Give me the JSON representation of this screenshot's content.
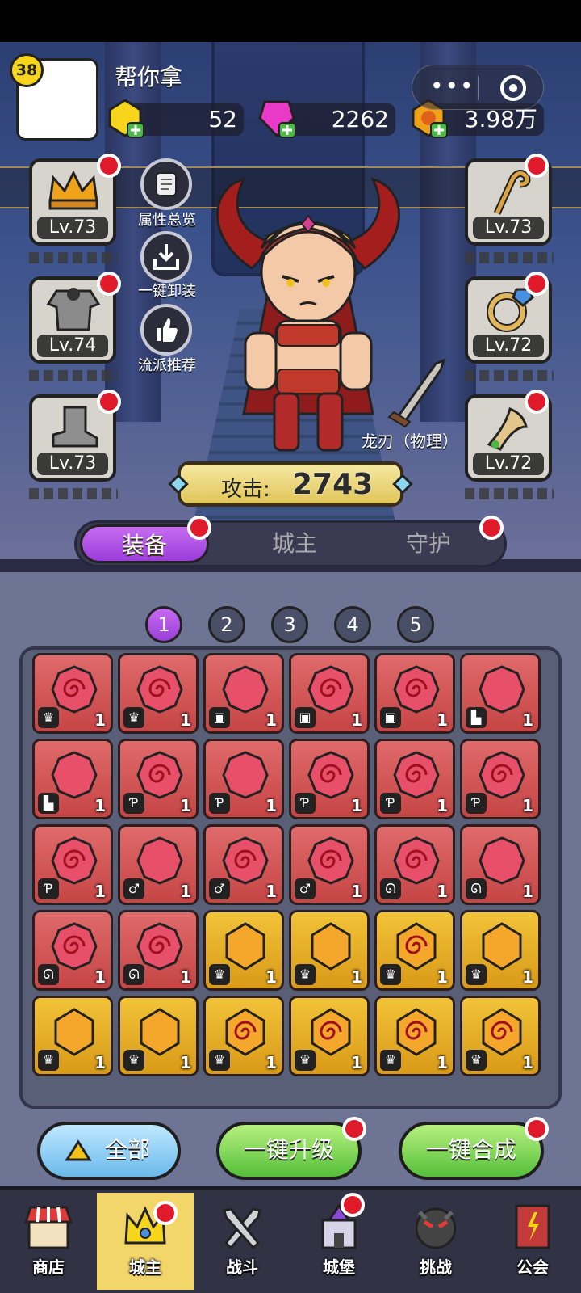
{
  "player": {
    "level": "38",
    "name": "帮你拿"
  },
  "currencies": [
    {
      "icon": "gold-gem-icon",
      "value": "52"
    },
    {
      "icon": "pink-diamond-icon",
      "value": "2262"
    },
    {
      "icon": "coin-icon",
      "value": "3.98万"
    }
  ],
  "equip_left": [
    {
      "icon": "crown-icon",
      "level": "Lv.73"
    },
    {
      "icon": "armor-icon",
      "level": "Lv.74"
    },
    {
      "icon": "boots-icon",
      "level": "Lv.73"
    }
  ],
  "equip_right": [
    {
      "icon": "staff-icon",
      "level": "Lv.73"
    },
    {
      "icon": "ring-icon",
      "level": "Lv.72"
    },
    {
      "icon": "horn-icon",
      "level": "Lv.72"
    }
  ],
  "side_buttons": [
    {
      "icon": "scroll-icon",
      "label": "属性总览"
    },
    {
      "icon": "unequip-icon",
      "label": "一键卸装"
    },
    {
      "icon": "thumbs-up-icon",
      "label": "流派推荐"
    }
  ],
  "weapon": {
    "label": "龙刃（物理）"
  },
  "attack": {
    "label": "攻击:",
    "value": "2743"
  },
  "tabs": [
    {
      "label": "装备"
    },
    {
      "label": "城主"
    },
    {
      "label": "守护"
    }
  ],
  "pages": [
    "1",
    "2",
    "3",
    "4",
    "5"
  ],
  "inventory": [
    {
      "color": "red",
      "swirl": true,
      "slot": "♛",
      "count": "1"
    },
    {
      "color": "red",
      "swirl": true,
      "slot": "♛",
      "count": "1"
    },
    {
      "color": "red",
      "swirl": false,
      "slot": "▣",
      "count": "1"
    },
    {
      "color": "red",
      "swirl": true,
      "slot": "▣",
      "count": "1"
    },
    {
      "color": "red",
      "swirl": true,
      "slot": "▣",
      "count": "1"
    },
    {
      "color": "red",
      "swirl": false,
      "slot": "▙",
      "count": "1"
    },
    {
      "color": "red",
      "swirl": false,
      "slot": "▙",
      "count": "1"
    },
    {
      "color": "red",
      "swirl": true,
      "slot": "Ƥ",
      "count": "1"
    },
    {
      "color": "red",
      "swirl": false,
      "slot": "Ƥ",
      "count": "1"
    },
    {
      "color": "red",
      "swirl": true,
      "slot": "Ƥ",
      "count": "1"
    },
    {
      "color": "red",
      "swirl": true,
      "slot": "Ƥ",
      "count": "1"
    },
    {
      "color": "red",
      "swirl": true,
      "slot": "Ƥ",
      "count": "1"
    },
    {
      "color": "red",
      "swirl": true,
      "slot": "Ƥ",
      "count": "1"
    },
    {
      "color": "red",
      "swirl": false,
      "slot": "♂",
      "count": "1"
    },
    {
      "color": "red",
      "swirl": true,
      "slot": "♂",
      "count": "1"
    },
    {
      "color": "red",
      "swirl": true,
      "slot": "♂",
      "count": "1"
    },
    {
      "color": "red",
      "swirl": true,
      "slot": "ᘏ",
      "count": "1"
    },
    {
      "color": "red",
      "swirl": false,
      "slot": "ᘏ",
      "count": "1"
    },
    {
      "color": "red",
      "swirl": true,
      "slot": "ᘏ",
      "count": "1"
    },
    {
      "color": "red",
      "swirl": true,
      "slot": "ᘏ",
      "count": "1"
    },
    {
      "color": "gold",
      "swirl": false,
      "slot": "♛",
      "count": "1"
    },
    {
      "color": "gold",
      "swirl": false,
      "slot": "♛",
      "count": "1"
    },
    {
      "color": "gold",
      "swirl": true,
      "slot": "♛",
      "count": "1"
    },
    {
      "color": "gold",
      "swirl": false,
      "slot": "♛",
      "count": "1"
    },
    {
      "color": "gold",
      "swirl": false,
      "slot": "♛",
      "count": "1"
    },
    {
      "color": "gold",
      "swirl": false,
      "slot": "♛",
      "count": "1"
    },
    {
      "color": "gold",
      "swirl": true,
      "slot": "♛",
      "count": "1"
    },
    {
      "color": "gold",
      "swirl": true,
      "slot": "♛",
      "count": "1"
    },
    {
      "color": "gold",
      "swirl": true,
      "slot": "♛",
      "count": "1"
    },
    {
      "color": "gold",
      "swirl": true,
      "slot": "♛",
      "count": "1"
    }
  ],
  "actions": [
    {
      "label": "全部"
    },
    {
      "label": "一键升级"
    },
    {
      "label": "一键合成"
    }
  ],
  "nav": [
    {
      "icon": "shop-icon",
      "label": "商店"
    },
    {
      "icon": "lord-icon",
      "label": "城主"
    },
    {
      "icon": "battle-icon",
      "label": "战斗"
    },
    {
      "icon": "castle-icon",
      "label": "城堡"
    },
    {
      "icon": "challenge-icon",
      "label": "挑战"
    },
    {
      "icon": "guild-icon",
      "label": "公会"
    }
  ],
  "colors": {
    "tab_active": "#a64be0",
    "red_item": "#d55555",
    "gold_item": "#e6ad25",
    "notify": "#e01a2b"
  }
}
